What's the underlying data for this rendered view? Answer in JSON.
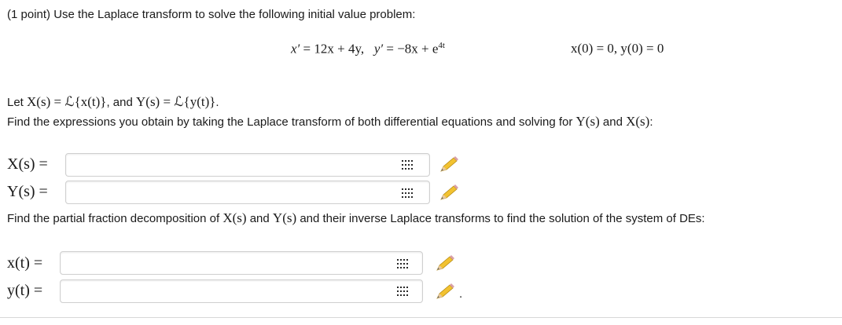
{
  "problem": {
    "intro": "(1 point) Use the Laplace transform to solve the following initial value problem:",
    "system": {
      "eq1_lhs": "x′",
      "eq1_rhs": "= 12x + 4y,",
      "eq2_lhs": "y′",
      "eq2_rhs": "= −8x + e",
      "eq2_exp": "4t",
      "initial": "x(0) = 0,  y(0) = 0"
    },
    "let_prefix": "Let",
    "let_X": "X(s) = ℒ{x(t)}",
    "let_and": ", and",
    "let_Y": "Y(s) = ℒ{y(t)}",
    "let_end": ".",
    "find_text_1_pre": "Find the expressions you obtain by taking the Laplace transform of both differential equations and solving for",
    "find_text_1_Y": "Y(s)",
    "find_text_1_and": "and",
    "find_text_1_X": "X(s)",
    "find_text_1_end": ":",
    "find_text_2_pre": "Find the partial fraction decomposition of",
    "find_text_2_X": "X(s)",
    "find_text_2_and": "and",
    "find_text_2_Y": "Y(s)",
    "find_text_2_post": "and their inverse Laplace transforms to find the solution of the system of DEs:"
  },
  "answers": {
    "X_label": "X(s) =",
    "X_value": "",
    "Y_label": "Y(s) =",
    "Y_value": "",
    "x_label": "x(t) =",
    "x_value": "",
    "y_label": "y(t) =",
    "y_value": "",
    "trailing_period": "."
  },
  "icons": {
    "matrix": "matrix-grid-icon",
    "editor": "pencil-icon"
  },
  "colors": {
    "pencil_body": "#f2c230",
    "pencil_tip": "#6f6f6f",
    "pencil_eraser": "#d9a0a8",
    "input_border": "#cfcfcf"
  }
}
